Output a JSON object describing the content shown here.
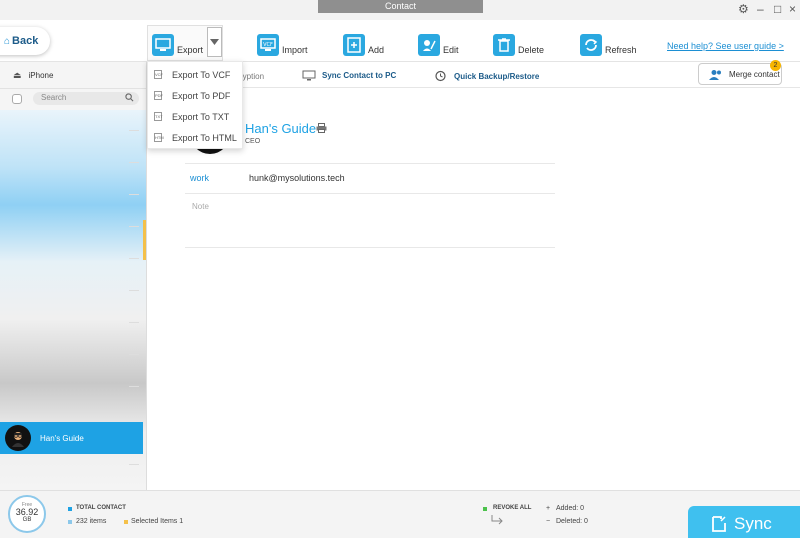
{
  "window": {
    "title": "Contact"
  },
  "toolbar": {
    "back": "Back",
    "export": "Export",
    "import": "Import",
    "add": "Add",
    "edit": "Edit",
    "delete": "Delete",
    "refresh": "Refresh",
    "help": "Need help? See user guide >"
  },
  "export_menu": {
    "items": [
      {
        "label": "Export To VCF",
        "icon": "VCF"
      },
      {
        "label": "Export To PDF",
        "icon": "PDF"
      },
      {
        "label": "Export To TXT",
        "icon": "TXT"
      },
      {
        "label": "Export To HTML",
        "icon": "HTM"
      }
    ]
  },
  "sidebar": {
    "device": "iPhone",
    "search_placeholder": "Search",
    "selected_contact": "Han's Guide"
  },
  "tabs": {
    "encryption_partial": "ryption",
    "sync": "Sync Contact to PC",
    "backup": "Quick Backup/Restore",
    "merge": "Merge contact",
    "merge_badge": "2"
  },
  "detail": {
    "name": "Han's Guide",
    "title": "CEO",
    "email_label": "work",
    "email": "hunk@mysolutions.tech",
    "note_placeholder": "Note"
  },
  "footer": {
    "storage_label": "Free",
    "storage_value": "36.92",
    "storage_unit": "GB",
    "total_label": "TOTAL CONTACT",
    "items": "232 items",
    "selected": "Selected Items 1",
    "revoke": "REVOKE ALL",
    "added": "Added: 0",
    "deleted": "Deleted: 0",
    "sync": "Sync"
  },
  "colors": {
    "accent": "#1ea2e4",
    "icon_blue": "#2aa8e0",
    "dark_text": "#1c5b89",
    "sync": "#3fc0ef"
  }
}
